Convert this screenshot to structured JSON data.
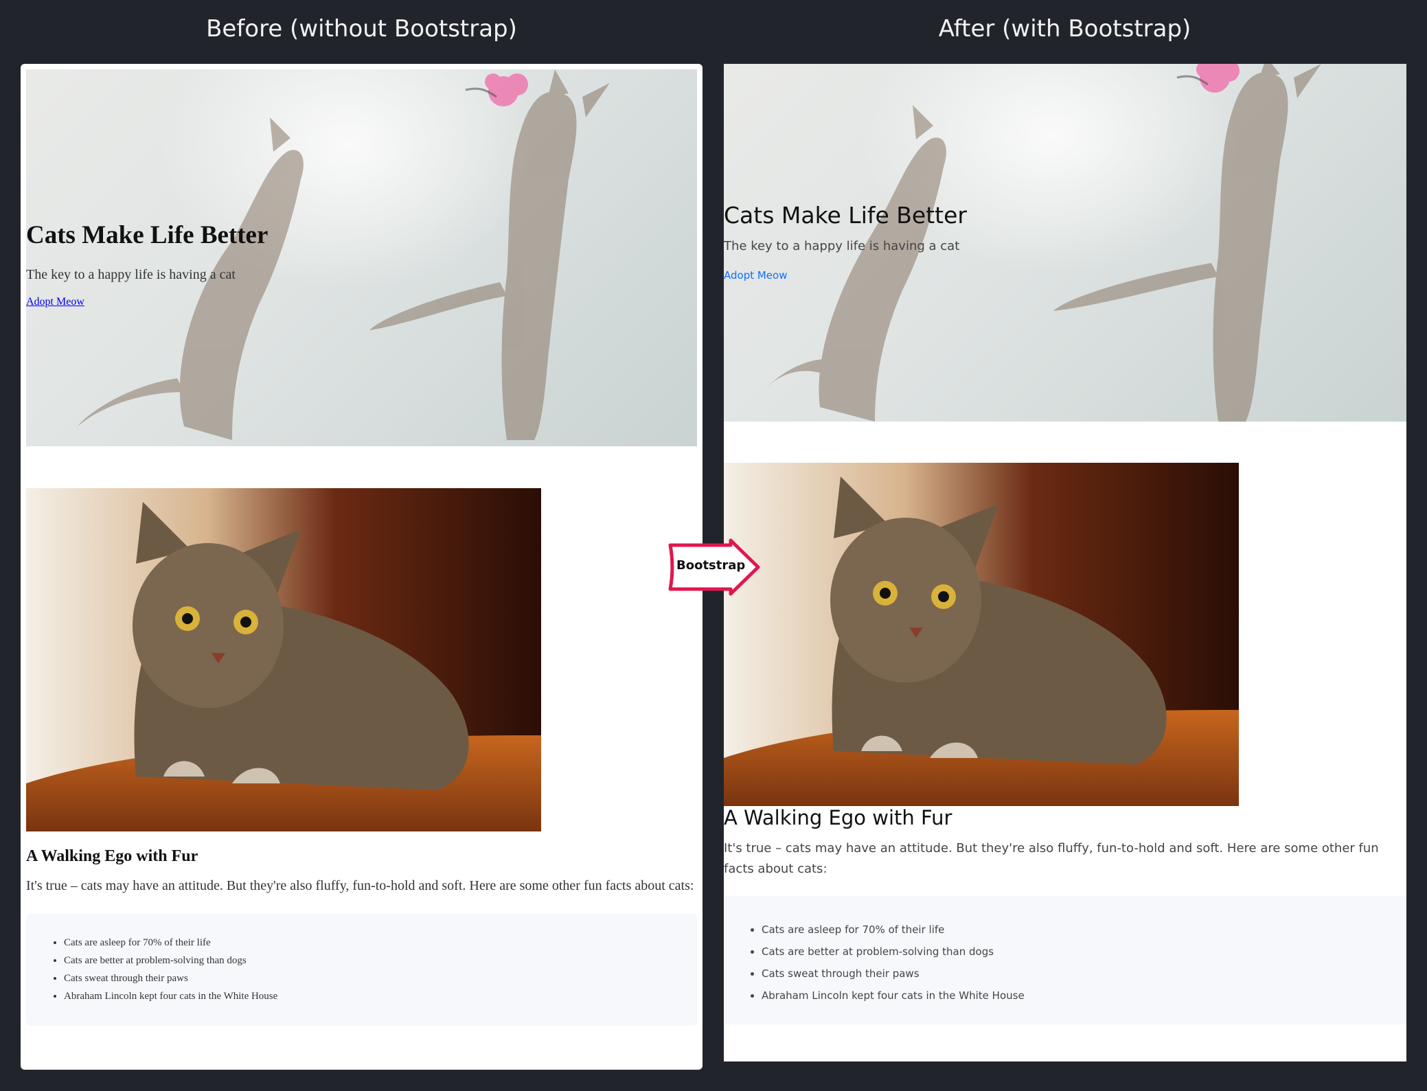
{
  "columns": {
    "before_title": "Before (without Bootstrap)",
    "after_title": "After (with Bootstrap)"
  },
  "hero": {
    "title": "Cats Make Life Better",
    "subtitle": "The key to a happy life is having a cat",
    "link": "Adopt Meow"
  },
  "section": {
    "heading": "A Walking Ego with Fur",
    "text": "It's true – cats may have an attitude. But they're also fluffy, fun-to-hold and soft. Here are some other fun facts about cats:"
  },
  "facts": [
    "Cats are asleep for 70% of their life",
    "Cats are better at problem-solving than dogs",
    "Cats sweat through their paws",
    "Abraham Lincoln kept four cats in the White House"
  ],
  "arrow": {
    "label": "Bootstrap",
    "color": "#e0174f"
  },
  "colors": {
    "background": "#21252b",
    "link_default": "#0000ee",
    "link_bootstrap": "#0d6efd",
    "facts_bg": "#f6f8fb"
  }
}
